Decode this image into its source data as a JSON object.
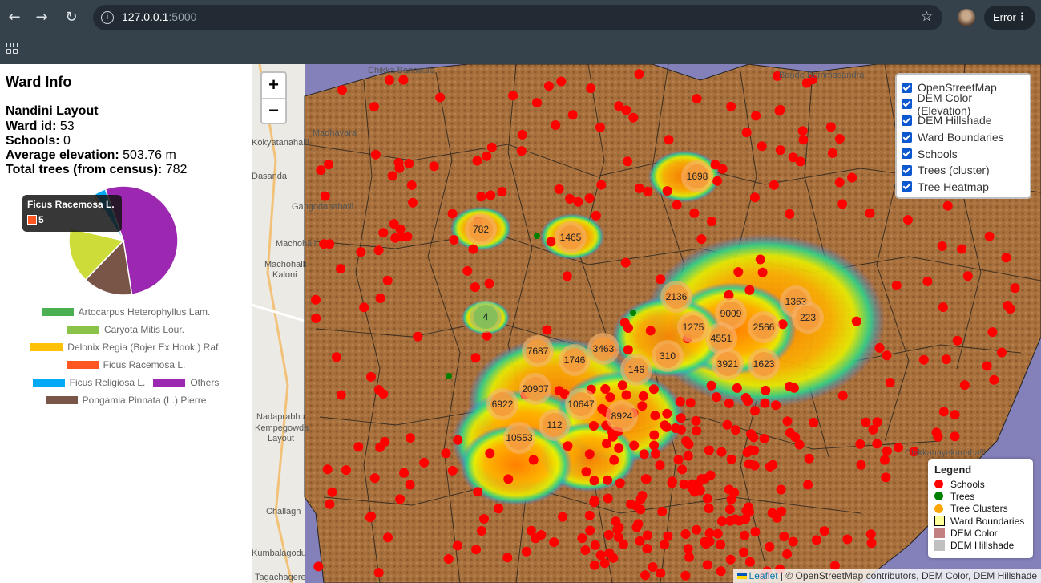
{
  "browser": {
    "url_host": "127.0.0.1",
    "url_port": ":5000",
    "profile_chip": "Error"
  },
  "panel": {
    "title": "Ward Info",
    "ward_name": "Nandini Layout",
    "ward_id_label": "Ward id:",
    "ward_id": "53",
    "schools_label": "Schools:",
    "schools": "0",
    "elevation_label": "Average elevation:",
    "elevation": "503.76 m",
    "trees_label": "Total trees (from census):",
    "trees": "782"
  },
  "tooltip": {
    "title": "Ficus Racemosa L.",
    "value": "5"
  },
  "chart_data": {
    "type": "pie",
    "total": 782,
    "slices": [
      {
        "name": "Artocarpus Heterophyllus Lam.",
        "value": 4,
        "color": "#4caf50"
      },
      {
        "name": "Caryota Mitis Lour.",
        "value": 2,
        "color": "#8bc34a"
      },
      {
        "name": "Delonix Regia (Bojer Ex Hook.) Raf.",
        "value": 2,
        "color": "#ffc107"
      },
      {
        "name": "Ficus Racemosa L.",
        "value": 5,
        "color": "#ff5722"
      },
      {
        "name": "Ficus Religiosa L.",
        "value": 27,
        "color": "#03a9f4"
      },
      {
        "name": "Others",
        "value": 414,
        "color": "#9c27b0"
      },
      {
        "name": "Pongamia Pinnata (L.) Pierre",
        "value": 115,
        "color": "#795548"
      },
      {
        "name": "",
        "value": 128,
        "color": "#cddc39"
      },
      {
        "name": "",
        "value": 85,
        "color": "#ffffff"
      }
    ]
  },
  "pie_legend": [
    {
      "label": "Artocarpus Heterophyllus Lam.",
      "color": "#4caf50"
    },
    {
      "label": "Caryota Mitis Lour.",
      "color": "#8bc34a"
    },
    {
      "label": "Delonix Regia (Bojer Ex Hook.) Raf.",
      "color": "#ffc107"
    },
    {
      "label": "Ficus Racemosa L.",
      "color": "#ff5722"
    },
    {
      "label": "Ficus Religiosa L.",
      "color": "#03a9f4"
    },
    {
      "label": "Others",
      "color": "#9c27b0"
    },
    {
      "label": "Pongamia Pinnata (L.) Pierre",
      "color": "#795548"
    }
  ],
  "map": {
    "zoom_in": "+",
    "zoom_out": "−",
    "layers": [
      "OpenStreetMap",
      "DEM Color (Elevation)",
      "DEM Hillshade",
      "Ward Boundaries",
      "Schools",
      "Trees (cluster)",
      "Tree Heatmap"
    ],
    "legend_title": "Legend",
    "legend_items": [
      {
        "label": "Schools",
        "color": "#ff0000"
      },
      {
        "label": "Trees",
        "color": "#008000"
      },
      {
        "label": "Tree Clusters",
        "color": "#ffa500"
      },
      {
        "label": "Ward Boundaries",
        "color": "#ffff99"
      },
      {
        "label": "DEM Color",
        "color": "#c28080"
      },
      {
        "label": "DEM Hillshade",
        "color": "#c0c0c0"
      }
    ],
    "attribution_link": "Leaflet",
    "attribution_rest": " | © OpenStreetMap contributors, DEM Color, DEM Hillshade",
    "place_labels": [
      "Chikka Banavara",
      "Bande Bommasandra",
      "Madhavara",
      "Kokyatanahalli",
      "Dasanda",
      "Gangodanahalli",
      "Machohalli",
      "Machohalli",
      "Kaloni",
      "Nadaprabhu",
      "Kempegowda",
      "Layout",
      "Challagh",
      "Kumbalagodu",
      "Tagachagere",
      "Chikkanayakanahalli"
    ],
    "clusters": [
      {
        "label": "1698",
        "kind": "orange"
      },
      {
        "label": "782",
        "kind": "orange"
      },
      {
        "label": "1465",
        "kind": "orange"
      },
      {
        "label": "2136",
        "kind": "orange"
      },
      {
        "label": "1363",
        "kind": "orange"
      },
      {
        "label": "9009",
        "kind": "orange"
      },
      {
        "label": "223",
        "kind": "orange"
      },
      {
        "label": "4",
        "kind": "green"
      },
      {
        "label": "1275",
        "kind": "orange"
      },
      {
        "label": "2566",
        "kind": "orange"
      },
      {
        "label": "4551",
        "kind": "orange"
      },
      {
        "label": "7687",
        "kind": "orange"
      },
      {
        "label": "3463",
        "kind": "orange"
      },
      {
        "label": "1746",
        "kind": "orange"
      },
      {
        "label": "310",
        "kind": "orange"
      },
      {
        "label": "3921",
        "kind": "orange"
      },
      {
        "label": "1623",
        "kind": "orange"
      },
      {
        "label": "146",
        "kind": "orange"
      },
      {
        "label": "20907",
        "kind": "orange"
      },
      {
        "label": "6922",
        "kind": "orange"
      },
      {
        "label": "10647",
        "kind": "orange"
      },
      {
        "label": "8924",
        "kind": "orange"
      },
      {
        "label": "112",
        "kind": "orange"
      },
      {
        "label": "10553",
        "kind": "orange"
      }
    ]
  }
}
